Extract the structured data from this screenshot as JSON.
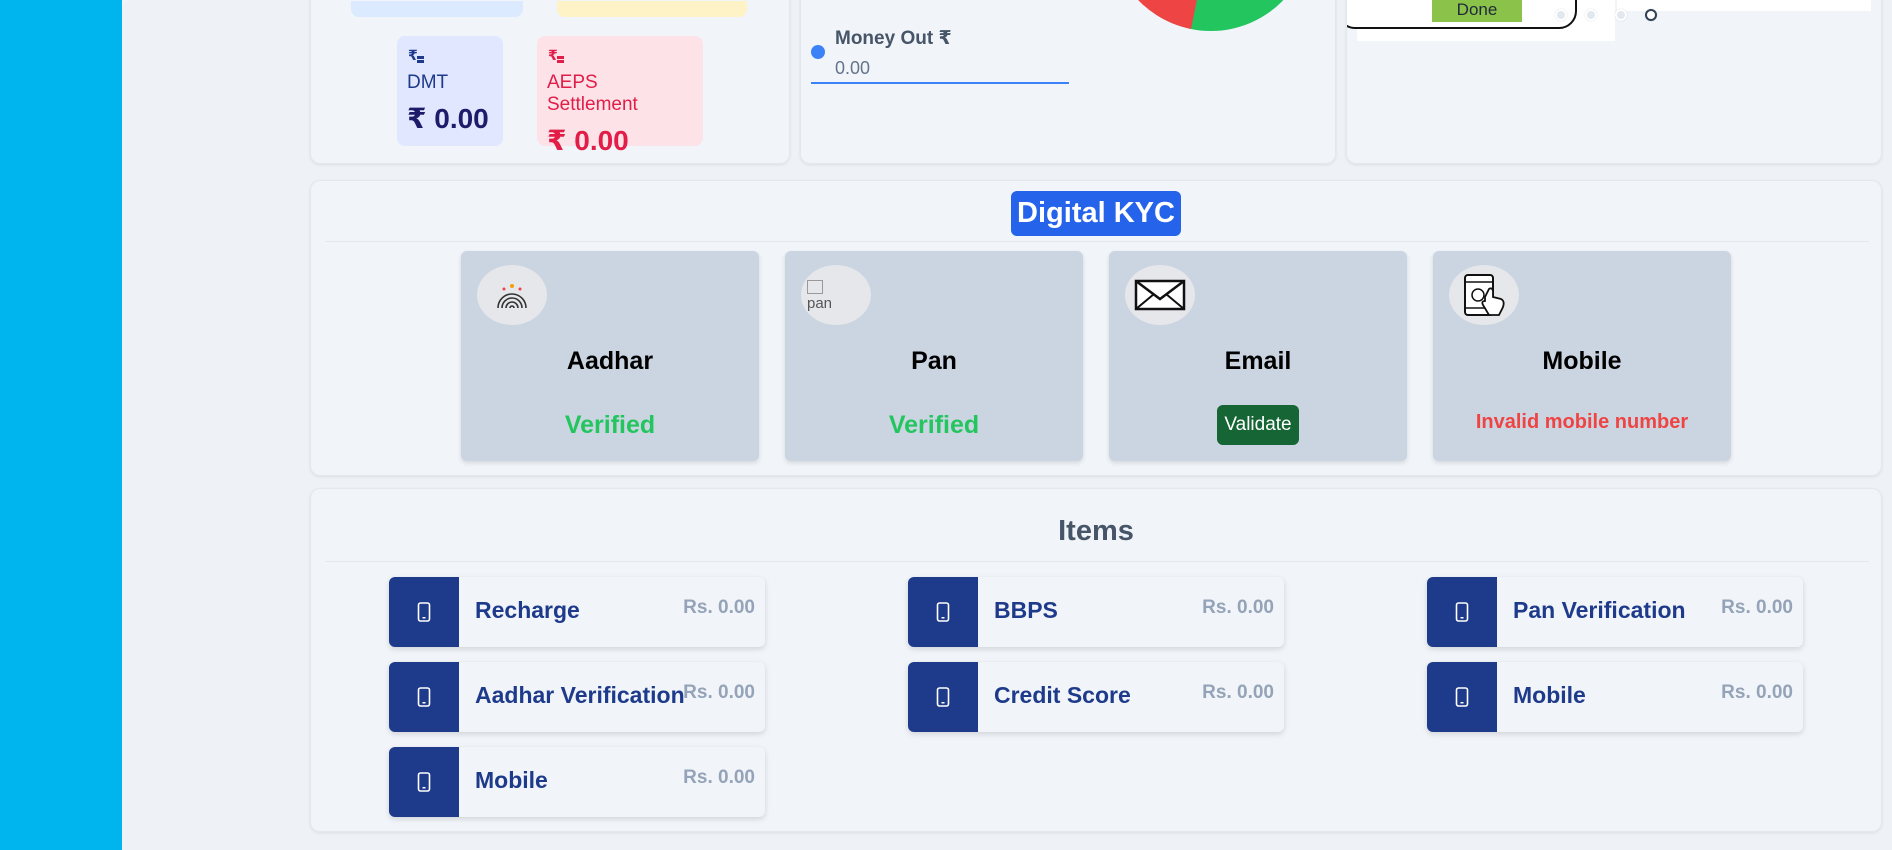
{
  "wallets": {
    "dmt": {
      "icon": "rupee-coins-icon",
      "label": "DMT",
      "amount": "₹ 0.00"
    },
    "aeps": {
      "icon": "rupee-coins-icon",
      "label": "AEPS Settlement",
      "amount": "₹ 0.00"
    }
  },
  "money": {
    "out_label": "Money Out ₹",
    "out_value": "0.00",
    "pie_colors": [
      "#ef4444",
      "#22c55e"
    ]
  },
  "slider": {
    "done_label": "Done"
  },
  "kyc": {
    "title": "Digital KYC",
    "items": [
      {
        "name": "Aadhar",
        "status": "Verified",
        "icon": "fingerprint-icon"
      },
      {
        "name": "Pan",
        "status": "Verified",
        "icon": "pan-image-broken",
        "alt": "pan"
      },
      {
        "name": "Email",
        "action": "Validate",
        "icon": "envelope-icon"
      },
      {
        "name": "Mobile",
        "status": "Invalid mobile number",
        "icon": "mobile-touch-icon"
      }
    ]
  },
  "items": {
    "title": "Items",
    "list": [
      {
        "label": "Recharge",
        "price": "Rs. 0.00"
      },
      {
        "label": "BBPS",
        "price": "Rs. 0.00"
      },
      {
        "label": "Pan Verification",
        "price": "Rs. 0.00"
      },
      {
        "label": "Aadhar Verification",
        "price": "Rs. 0.00"
      },
      {
        "label": "Credit Score",
        "price": "Rs. 0.00"
      },
      {
        "label": "Mobile",
        "price": "Rs. 0.00"
      },
      {
        "label": "Mobile",
        "price": "Rs. 0.00"
      }
    ]
  },
  "colors": {
    "sidebar": "#00b4ee",
    "kyc_title_bg": "#2563eb",
    "verified": "#22c55e",
    "invalid": "#ef4444",
    "item_icon_bg": "#1e3a8a"
  }
}
